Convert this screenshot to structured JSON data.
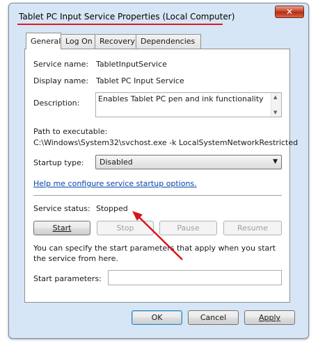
{
  "window": {
    "title": "Tablet PC Input Service Properties (Local Computer)",
    "close_glyph": "✕",
    "accent": "#e0181f"
  },
  "tabs": [
    {
      "label": "General",
      "active": true
    },
    {
      "label": "Log On"
    },
    {
      "label": "Recovery"
    },
    {
      "label": "Dependencies"
    }
  ],
  "general": {
    "service_name_label": "Service name:",
    "service_name_value": "TabletInputService",
    "display_name_label": "Display name:",
    "display_name_value": "Tablet PC Input Service",
    "description_label": "Description:",
    "description_value": "Enables Tablet PC pen and ink functionality",
    "path_label": "Path to executable:",
    "path_value": "C:\\Windows\\System32\\svchost.exe -k LocalSystemNetworkRestricted",
    "startup_type_label": "Startup type:",
    "startup_type_value": "Disabled",
    "help_link": "Help me configure service startup options.",
    "status_label": "Service status:",
    "status_value": "Stopped",
    "buttons": {
      "start": "Start",
      "stop": "Stop",
      "pause": "Pause",
      "resume": "Resume"
    },
    "start_params_note": "You can specify the start parameters that apply when you start the service from here.",
    "start_params_label": "Start parameters:",
    "start_params_value": ""
  },
  "footer": {
    "ok": "OK",
    "cancel": "Cancel",
    "apply": "Apply"
  },
  "annotation": {
    "arrow_color": "#d9141c"
  }
}
